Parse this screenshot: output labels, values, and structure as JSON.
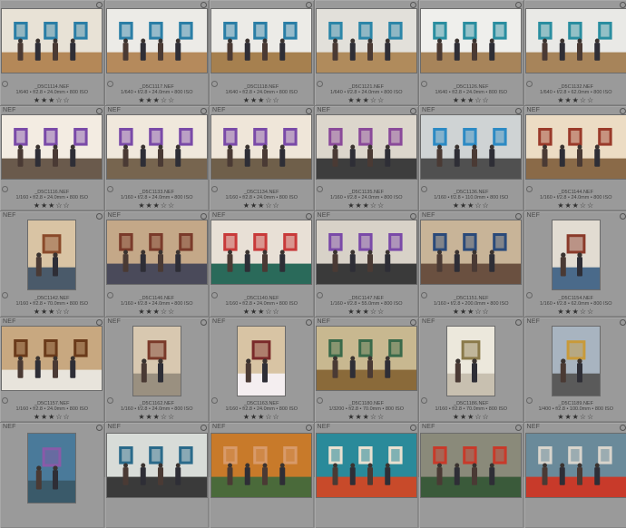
{
  "photos": [
    {
      "format": "",
      "filename": "_D5C1114.NEF",
      "meta": "1/640 • f/2.8 • 24.0mm • 800 ISO",
      "stars": "★★★☆☆",
      "orient": "land",
      "palette": [
        "#e8e2d6",
        "#2a7ea6",
        "#b48858"
      ]
    },
    {
      "format": "",
      "filename": "_D5C1117.NEF",
      "meta": "1/640 • f/2.8 • 24.0mm • 800 ISO",
      "stars": "★★★☆☆",
      "orient": "land",
      "palette": [
        "#ecebe7",
        "#2a7ea6",
        "#b58a5c"
      ]
    },
    {
      "format": "",
      "filename": "_D5C1118.NEF",
      "meta": "1/640 • f/2.8 • 24.0mm • 800 ISO",
      "stars": "★★★☆☆",
      "orient": "land",
      "palette": [
        "#ecebe7",
        "#2a7ea6",
        "#a6804f"
      ]
    },
    {
      "format": "",
      "filename": "_D5C1121.NEF",
      "meta": "1/640 • f/2.8 • 24.0mm • 800 ISO",
      "stars": "★★★☆☆",
      "orient": "land",
      "palette": [
        "#e2e0da",
        "#2c86a8",
        "#b08b5c"
      ]
    },
    {
      "format": "",
      "filename": "_D5C1126.NEF",
      "meta": "1/640 • f/2.8 • 24.0mm • 800 ISO",
      "stars": "★★★☆☆",
      "orient": "land",
      "palette": [
        "#efefec",
        "#2a8ea0",
        "#a7845a"
      ]
    },
    {
      "format": "",
      "filename": "_D5C1132.NEF",
      "meta": "1/640 • f/2.8 • 62.0mm • 800 ISO",
      "stars": "★★★☆☆",
      "orient": "land",
      "palette": [
        "#e9e9e6",
        "#2a8ea0",
        "#a7845a"
      ]
    },
    {
      "format": "NEF",
      "filename": "_D5C1116.NEF",
      "meta": "1/160 • f/2.8 • 24.0mm • 800 ISO",
      "stars": "★★★☆☆",
      "orient": "land",
      "palette": [
        "#f3ece2",
        "#7a4aa8",
        "#6a5a4c"
      ]
    },
    {
      "format": "NEF",
      "filename": "_D5C1133.NEF",
      "meta": "1/160 • f/2.8 • 24.0mm • 800 ISO",
      "stars": "★★★☆☆",
      "orient": "land",
      "palette": [
        "#f0e8dc",
        "#7a4aa8",
        "#77654f"
      ]
    },
    {
      "format": "NEF",
      "filename": "_D5C1134.NEF",
      "meta": "1/160 • f/2.8 • 24.0mm • 800 ISO",
      "stars": "★★★☆☆",
      "orient": "land",
      "palette": [
        "#efe6d9",
        "#7a4aa8",
        "#6f5f4a"
      ]
    },
    {
      "format": "NEF",
      "filename": "_D5C1135.NEF",
      "meta": "1/160 • f/2.8 • 24.0mm • 800 ISO",
      "stars": "★★★☆☆",
      "orient": "land",
      "palette": [
        "#dcd6cc",
        "#8a4a9a",
        "#3d3d3d"
      ]
    },
    {
      "format": "NEF",
      "filename": "_D5C1136.NEF",
      "meta": "1/160 • f/2.8 • 110.0mm • 800 ISO",
      "stars": "★★★☆☆",
      "orient": "land",
      "palette": [
        "#cfd3d4",
        "#2c8ac4",
        "#505050"
      ]
    },
    {
      "format": "NEF",
      "filename": "_D5C1144.NEF",
      "meta": "1/160 • f/2.8 • 24.0mm • 800 ISO",
      "stars": "★★★☆☆",
      "orient": "land",
      "palette": [
        "#ecdcc4",
        "#9a3a2a",
        "#8a6a48"
      ]
    },
    {
      "format": "NEF",
      "filename": "_D5C1142.NEF",
      "meta": "1/160 • f/2.8 • 70.0mm • 800 ISO",
      "stars": "★★★☆☆",
      "orient": "port",
      "palette": [
        "#d9c4a4",
        "#8a4a2a",
        "#4a5a6a"
      ]
    },
    {
      "format": "NEF",
      "filename": "_D5C1146.NEF",
      "meta": "1/160 • f/2.8 • 24.0mm • 800 ISO",
      "stars": "★★★☆☆",
      "orient": "land",
      "palette": [
        "#c4a888",
        "#7a3a2a",
        "#4a4a5a"
      ]
    },
    {
      "format": "NEF",
      "filename": "_D5C1140.NEF",
      "meta": "1/160 • f/2.8 • 24.0mm • 800 ISO",
      "stars": "★★★☆☆",
      "orient": "land",
      "palette": [
        "#e8e0d6",
        "#c83a3a",
        "#2a6a5a"
      ]
    },
    {
      "format": "NEF",
      "filename": "_D5C1147.NEF",
      "meta": "1/160 • f/2.8 • 55.0mm • 800 ISO",
      "stars": "★★★☆☆",
      "orient": "land",
      "palette": [
        "#d8d2c8",
        "#7a4aa8",
        "#3a3a3a"
      ]
    },
    {
      "format": "NEF",
      "filename": "_D5C1151.NEF",
      "meta": "1/160 • f/2.8 • 200.0mm • 800 ISO",
      "stars": "★★★☆☆",
      "orient": "land",
      "palette": [
        "#c8b498",
        "#2a4a7a",
        "#6a5040"
      ]
    },
    {
      "format": "NEF",
      "filename": "_D5C1154.NEF",
      "meta": "1/160 • f/2.8 • 62.0mm • 800 ISO",
      "stars": "★★★☆☆",
      "orient": "port",
      "palette": [
        "#e2dcd2",
        "#8a3a2a",
        "#4a6a8a"
      ]
    },
    {
      "format": "NEF",
      "filename": "_D5C1157.NEF",
      "meta": "1/160 • f/2.8 • 24.0mm • 800 ISO",
      "stars": "★★★☆☆",
      "orient": "land",
      "palette": [
        "#c8a880",
        "#6a3a1a",
        "#e8e4dc"
      ]
    },
    {
      "format": "NEF",
      "filename": "_D5C1162.NEF",
      "meta": "1/160 • f/2.8 • 24.0mm • 800 ISO",
      "stars": "★★★☆☆",
      "orient": "port",
      "palette": [
        "#d8c8b0",
        "#7a3a2a",
        "#9a9080"
      ]
    },
    {
      "format": "NEF",
      "filename": "_D5C1163.NEF",
      "meta": "1/160 • f/2.8 • 24.0mm • 800 ISO",
      "stars": "★★★☆☆",
      "orient": "port",
      "palette": [
        "#d8c4a4",
        "#7a2a2a",
        "#f4eef0"
      ]
    },
    {
      "format": "NEF",
      "filename": "_D5C1180.NEF",
      "meta": "1/3200 • f/2.8 • 70.0mm • 800 ISO",
      "stars": "★★★☆☆",
      "orient": "land",
      "palette": [
        "#c8b890",
        "#3a6a4a",
        "#8a6a3a"
      ]
    },
    {
      "format": "NEF",
      "filename": "_D5C1186.NEF",
      "meta": "1/160 • f/2.8 • 70.0mm • 800 ISO",
      "stars": "★★★☆☆",
      "orient": "port",
      "palette": [
        "#ece8dc",
        "#8a7a4a",
        "#c8c0b0"
      ]
    },
    {
      "format": "NEF",
      "filename": "_D5C1189.NEF",
      "meta": "1/400 • f/2.8 • 100.0mm • 800 ISO",
      "stars": "★★★☆☆",
      "orient": "port",
      "palette": [
        "#a8b4c0",
        "#c89a3a",
        "#5a5a5a"
      ]
    },
    {
      "format": "NEF",
      "filename": "",
      "meta": "",
      "stars": "",
      "orient": "port",
      "palette": [
        "#4a7a9a",
        "#8a5aa8",
        "#3a5a6a"
      ]
    },
    {
      "format": "NEF",
      "filename": "",
      "meta": "",
      "stars": "",
      "orient": "land",
      "palette": [
        "#d8dcd8",
        "#2a6a8a",
        "#3a3a3a"
      ]
    },
    {
      "format": "NEF",
      "filename": "",
      "meta": "",
      "stars": "",
      "orient": "land",
      "palette": [
        "#c87a2a",
        "#d89a6a",
        "#4a6a3a"
      ]
    },
    {
      "format": "NEF",
      "filename": "",
      "meta": "",
      "stars": "",
      "orient": "land",
      "palette": [
        "#2a8a9a",
        "#e8e0d0",
        "#c84a2a"
      ]
    },
    {
      "format": "NEF",
      "filename": "",
      "meta": "",
      "stars": "",
      "orient": "land",
      "palette": [
        "#8a8a7a",
        "#c83a2a",
        "#3a5a3a"
      ]
    },
    {
      "format": "NEF",
      "filename": "",
      "meta": "",
      "stars": "",
      "orient": "land",
      "palette": [
        "#6a8a9a",
        "#d8d4cc",
        "#c83a2a"
      ]
    }
  ]
}
